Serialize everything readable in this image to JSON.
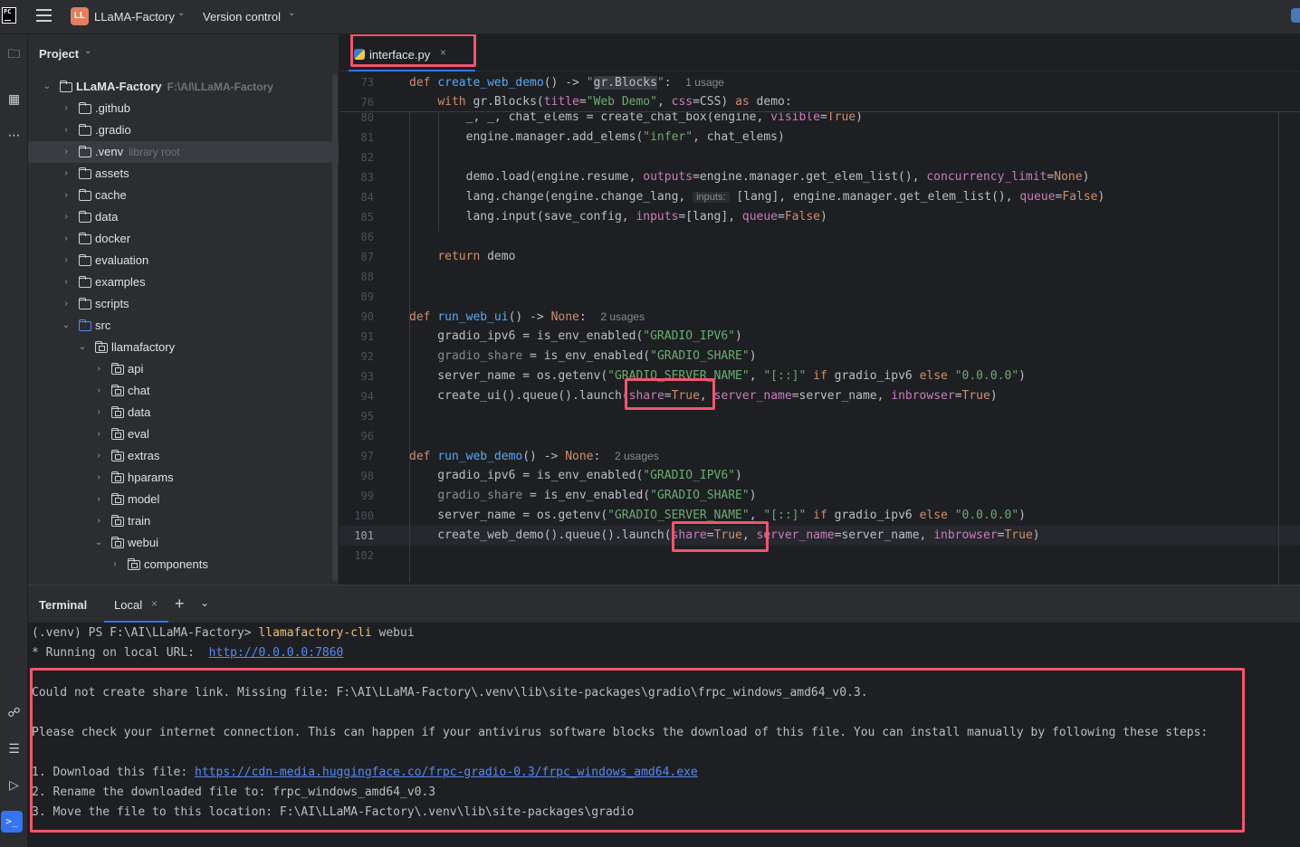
{
  "titlebar": {
    "project_badge": "LL",
    "project_name": "LLaMA-Factory",
    "vcs_label": "Version control"
  },
  "project_panel": {
    "title": "Project",
    "tree": [
      {
        "name": "LLaMA-Factory",
        "hint": "F:\\AI\\LLaMA-Factory",
        "depth": 0,
        "expanded": true,
        "bold": true
      },
      {
        "name": ".github",
        "depth": 1
      },
      {
        "name": ".gradio",
        "depth": 1
      },
      {
        "name": ".venv",
        "hint": "library root",
        "depth": 1,
        "selected": true
      },
      {
        "name": "assets",
        "depth": 1
      },
      {
        "name": "cache",
        "depth": 1
      },
      {
        "name": "data",
        "depth": 1
      },
      {
        "name": "docker",
        "depth": 1
      },
      {
        "name": "evaluation",
        "depth": 1
      },
      {
        "name": "examples",
        "depth": 1
      },
      {
        "name": "scripts",
        "depth": 1
      },
      {
        "name": "src",
        "depth": 1,
        "expanded": true,
        "blue": true
      },
      {
        "name": "llamafactory",
        "depth": 2,
        "expanded": true,
        "pkg": true
      },
      {
        "name": "api",
        "depth": 3,
        "pkg": true
      },
      {
        "name": "chat",
        "depth": 3,
        "pkg": true
      },
      {
        "name": "data",
        "depth": 3,
        "pkg": true
      },
      {
        "name": "eval",
        "depth": 3,
        "pkg": true
      },
      {
        "name": "extras",
        "depth": 3,
        "pkg": true
      },
      {
        "name": "hparams",
        "depth": 3,
        "pkg": true
      },
      {
        "name": "model",
        "depth": 3,
        "pkg": true
      },
      {
        "name": "train",
        "depth": 3,
        "pkg": true
      },
      {
        "name": "webui",
        "depth": 3,
        "expanded": true,
        "pkg": true
      },
      {
        "name": "components",
        "depth": 4,
        "pkg": true
      }
    ]
  },
  "editor": {
    "tab_label": "interface.py",
    "sticky_lines": [
      {
        "n": "73",
        "html": "<span class=\"kw\">def</span> <span class=\"fn\">create_web_demo</span>() -&gt; <span class=\"str\">\"</span><span style=\"background:#373b41\">gr.Blocks</span><span class=\"str\">\"</span>:  <span class=\"hint\">1 usage</span>"
      },
      {
        "n": "76",
        "html": "    <span class=\"kw\">with</span> gr.Blocks(<span class=\"prm\">title</span>=<span class=\"str\">\"Web Demo\"</span>, <span class=\"prm\">css</span>=CSS) <span class=\"kw\">as</span> demo:"
      }
    ],
    "lines": [
      {
        "n": "80",
        "html": "        _, _, chat_elems = create_chat_box(engine, <span class=\"prm\">visible</span>=<span class=\"kw\">True</span>)"
      },
      {
        "n": "81",
        "html": "        engine.manager.add_elems(<span class=\"str\">\"infer\"</span>, chat_elems)"
      },
      {
        "n": "82",
        "html": ""
      },
      {
        "n": "83",
        "html": "        demo.load(engine.resume, <span class=\"prm\">outputs</span>=engine.manager.get_elem_list(), <span class=\"prm\">concurrency_limit</span>=<span class=\"kw\">None</span>)"
      },
      {
        "n": "84",
        "html": "        lang.change(engine.change_lang, <span class=\"inlay\">inputs:</span> [lang], engine.manager.get_elem_list(), <span class=\"prm\">queue</span>=<span class=\"kw\">False</span>)"
      },
      {
        "n": "85",
        "html": "        lang.input(save_config, <span class=\"prm\">inputs</span>=[lang], <span class=\"prm\">queue</span>=<span class=\"kw\">False</span>)"
      },
      {
        "n": "86",
        "html": ""
      },
      {
        "n": "87",
        "html": "    <span class=\"kw\">return</span> demo"
      },
      {
        "n": "88",
        "html": ""
      },
      {
        "n": "89",
        "html": ""
      },
      {
        "n": "90",
        "html": "<span class=\"kw\">def</span> <span class=\"fn\">run_web_ui</span>() -&gt; <span class=\"kw\">None</span>:  <span class=\"hint\">2 usages</span>"
      },
      {
        "n": "91",
        "html": "    gradio_ipv6 = is_env_enabled(<span class=\"str\">\"GRADIO_IPV6\"</span>)"
      },
      {
        "n": "92",
        "html": "    <span class=\"grey\">gradio_share</span> = is_env_enabled(<span class=\"str\">\"GRADIO_SHARE\"</span>)"
      },
      {
        "n": "93",
        "html": "    server_name = os.getenv(<span class=\"str\">\"GRADIO_SERVER_NAME\"</span>, <span class=\"str\">\"[::]\"</span> <span class=\"kw\">if</span> gradio_ipv6 <span class=\"kw\">else</span> <span class=\"str\">\"0.0.0.0\"</span>)"
      },
      {
        "n": "94",
        "html": "    create_ui().queue().launch(<span class=\"prm\">share</span>=<span class=\"kw\">True</span>, <span class=\"prm\">server_name</span>=server_name, <span class=\"prm\">inbrowser</span>=<span class=\"kw\">True</span>)"
      },
      {
        "n": "95",
        "html": ""
      },
      {
        "n": "96",
        "html": ""
      },
      {
        "n": "97",
        "html": "<span class=\"kw\">def</span> <span class=\"fn\">run_web_demo</span>() -&gt; <span class=\"kw\">None</span>:  <span class=\"hint\">2 usages</span>"
      },
      {
        "n": "98",
        "html": "    gradio_ipv6 = is_env_enabled(<span class=\"str\">\"GRADIO_IPV6\"</span>)"
      },
      {
        "n": "99",
        "html": "    <span class=\"grey\">gradio_share</span> = is_env_enabled(<span class=\"str\">\"GRADIO_SHARE\"</span>)"
      },
      {
        "n": "100",
        "html": "    server_name = os.getenv(<span class=\"str\">\"GRADIO_SERVER_NAME\"</span>, <span class=\"str\">\"[::]\"</span> <span class=\"kw\">if</span> gradio_ipv6 <span class=\"kw\">else</span> <span class=\"str\">\"0.0.0.0\"</span>)"
      },
      {
        "n": "101",
        "html": "    create_web_demo().queue().launch(<span class=\"prm\">share</span>=<span class=\"kw\">True</span>, <span class=\"prm\">server_name</span>=server_name, <span class=\"prm\">inbrowser</span>=<span class=\"kw\">True</span>)",
        "current": true
      },
      {
        "n": "102",
        "html": ""
      }
    ]
  },
  "terminal": {
    "title": "Terminal",
    "tab_label": "Local",
    "prompt": "(.venv) PS F:\\AI\\LLaMA-Factory> ",
    "command": "llamafactory-cli",
    "command_arg": " webui",
    "running_prefix": "* Running on local URL:  ",
    "running_url": "http://0.0.0.0:7860",
    "error_line": "Could not create share link. Missing file: F:\\AI\\LLaMA-Factory\\.venv\\lib\\site-packages\\gradio\\frpc_windows_amd64_v0.3.",
    "check_line": "Please check your internet connection. This can happen if your antivirus software blocks the download of this file. You can install manually by following these steps:",
    "step1_prefix": "1. Download this file: ",
    "step1_url": "https://cdn-media.huggingface.co/frpc-gradio-0.3/frpc_windows_amd64.exe",
    "step2": "2. Rename the downloaded file to: frpc_windows_amd64_v0.3",
    "step3": "3. Move the file to this location: F:\\AI\\LLaMA-Factory\\.venv\\lib\\site-packages\\gradio"
  },
  "colors": {
    "accent": "#3574f0",
    "highlight_box": "#f0566e"
  }
}
